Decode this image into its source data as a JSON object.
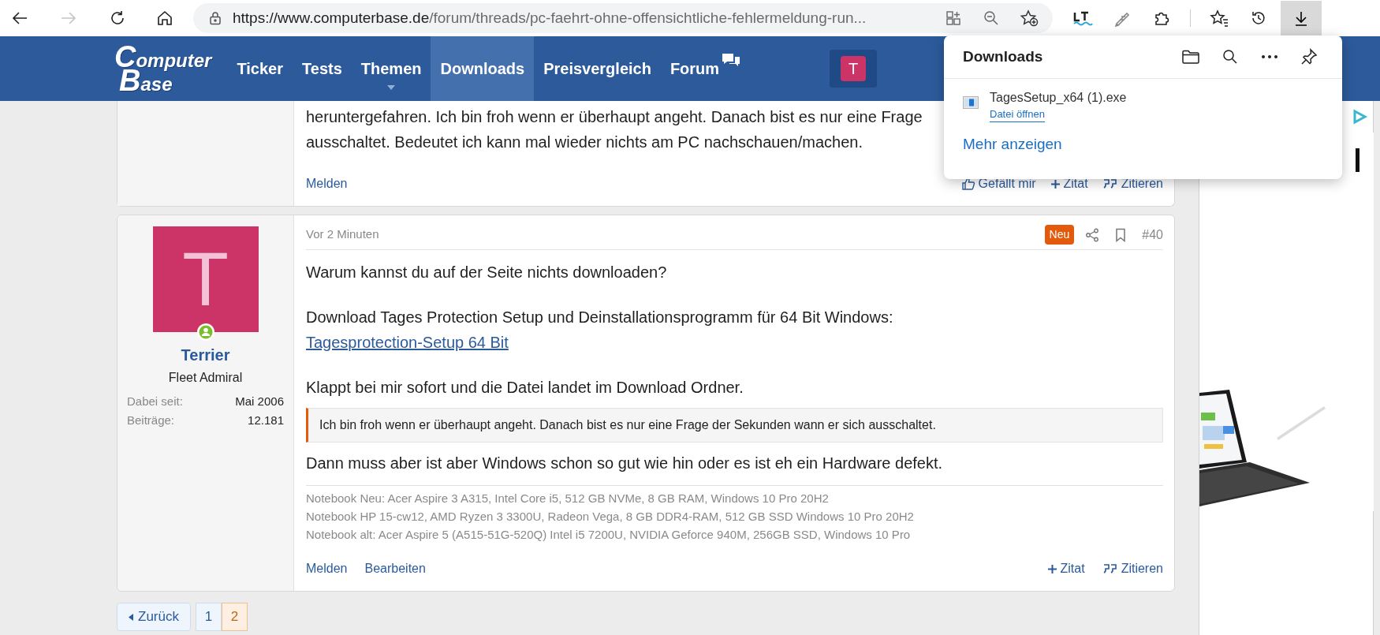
{
  "browser": {
    "url_host": "https://www.computerbase.de",
    "url_path": "/forum/threads/pc-faehrt-ohne-offensichtliche-fehlermeldung-run...",
    "forward_disabled": true,
    "downloads_open": true
  },
  "site_header": {
    "logo_top": "Computer",
    "logo_bottom": "Base",
    "user_initial": "T",
    "nav": [
      {
        "label": "Ticker",
        "selected": false,
        "dropdown": false,
        "chat_icon": false
      },
      {
        "label": "Tests",
        "selected": false,
        "dropdown": false,
        "chat_icon": false
      },
      {
        "label": "Themen",
        "selected": false,
        "dropdown": true,
        "chat_icon": false
      },
      {
        "label": "Downloads",
        "selected": true,
        "dropdown": false,
        "chat_icon": false
      },
      {
        "label": "Preisvergleich",
        "selected": false,
        "dropdown": false,
        "chat_icon": false
      },
      {
        "label": "Forum",
        "selected": false,
        "dropdown": false,
        "chat_icon": true
      }
    ]
  },
  "downloads_panel": {
    "title": "Downloads",
    "items": [
      {
        "filename": "TagesSetup_x64 (1).exe",
        "action": "Datei öffnen"
      }
    ],
    "more": "Mehr anzeigen"
  },
  "previous_post": {
    "lines": [
      "heruntergefahren. Ich bin froh wenn er überhaupt angeht. Danach bist es nur eine Frage",
      "ausschaltet. Bedeutet ich kann mal wieder nichts am PC nachschauen/machen."
    ],
    "actions_left": [
      "Melden"
    ],
    "actions_right": [
      {
        "kind": "like",
        "label": "Gefällt mir"
      },
      {
        "kind": "plus",
        "label": "Zitat"
      },
      {
        "kind": "quote",
        "label": "Zitieren"
      }
    ]
  },
  "post": {
    "author": {
      "initial": "T",
      "online": true,
      "name": "Terrier",
      "rank": "Fleet Admiral",
      "stats": [
        {
          "label": "Dabei seit:",
          "value": "Mai 2006"
        },
        {
          "label": "Beiträge:",
          "value": "12.181"
        }
      ]
    },
    "time": "Vor 2 Minuten",
    "badge": "Neu",
    "number": "#40",
    "body": [
      {
        "kind": "text",
        "text": "Warum kannst du auf der Seite nichts downloaden?"
      },
      {
        "kind": "gap"
      },
      {
        "kind": "text",
        "text": "Download Tages Protection Setup und Deinstallationsprogramm für 64 Bit Windows:"
      },
      {
        "kind": "link",
        "text": "Tagesprotection-Setup 64 Bit"
      },
      {
        "kind": "gap"
      },
      {
        "kind": "text",
        "text": "Klappt bei mir sofort und die Datei landet im Download Ordner."
      },
      {
        "kind": "quote",
        "text": "Ich bin froh wenn er überhaupt angeht. Danach bist es nur eine Frage der Sekunden wann er sich ausschaltet."
      },
      {
        "kind": "text",
        "text": "Dann muss aber ist aber Windows schon so gut wie hin oder es ist eh ein Hardware defekt."
      }
    ],
    "signature": [
      "Notebook Neu: Acer Aspire 3 A315, Intel Core i5, 512 GB NVMe, 8 GB RAM, Windows 10 Pro 20H2",
      "Notebook HP 15-cw12, AMD Ryzen 3 3300U, Radeon Vega, 8 GB DDR4-RAM, 512 GB SSD Windows 10 Pro 20H2",
      "Notebook alt: Acer Aspire 5 (A515-51G-520Q) Intel i5 7200U, NVIDIA Geforce 940M, 256GB SSD, Windows 10 Pro"
    ],
    "actions_left": [
      "Melden",
      "Bearbeiten"
    ],
    "actions_right": [
      {
        "kind": "plus",
        "label": "Zitat"
      },
      {
        "kind": "quote",
        "label": "Zitieren"
      }
    ]
  },
  "pagination": {
    "prev": "Zurück",
    "pages": [
      {
        "label": "1",
        "selected": false
      },
      {
        "label": "2",
        "selected": true
      }
    ]
  }
}
